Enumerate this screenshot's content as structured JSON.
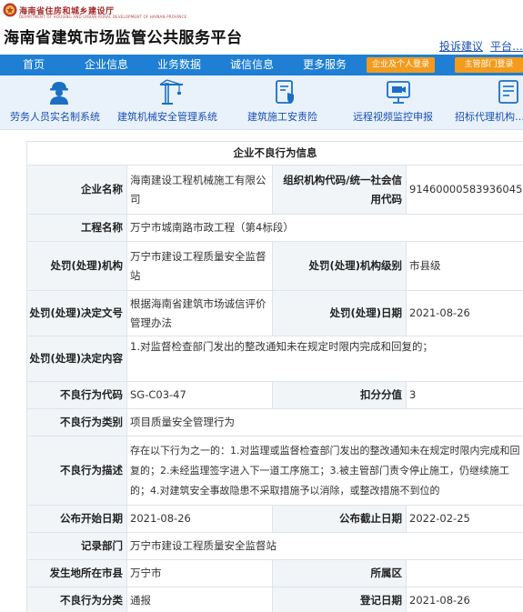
{
  "header": {
    "gov_name": "海南省住房和城乡建设厅",
    "gov_subtitle": "DEPARTMENT OF HOUSING AND URBAN-RURAL DEVELOPMENT OF HAINAN PROVINCE",
    "site_title": "海南省建筑市场监管公共服务平台",
    "links": [
      "投诉建议",
      "平台…"
    ]
  },
  "nav": {
    "items": [
      "首页",
      "企业信息",
      "业务数据",
      "诚信信息",
      "更多服务"
    ],
    "buttons": [
      "企业及个人登录",
      "主管部门登录"
    ]
  },
  "systems": [
    {
      "label": "劳务人员实名制系统",
      "icon": "worker-icon"
    },
    {
      "label": "建筑机械安全管理系统",
      "icon": "tower-crane-icon"
    },
    {
      "label": "建筑施工安责险",
      "icon": "insurance-document-icon"
    },
    {
      "label": "远程视频监控申报",
      "icon": "video-monitor-icon"
    },
    {
      "label": "招标代理机构…",
      "icon": "bidding-document-icon"
    }
  ],
  "record": {
    "title": "企业不良行为信息",
    "labels": {
      "company_name": "企业名称",
      "org_code": "组织机构代码/统一社会信用代码",
      "project_name": "工程名称",
      "penalty_agency": "处罚(处理)机构",
      "agency_level": "处罚(处理)机构级别",
      "decision_doc": "处罚(处理)决定文号",
      "decision_date": "处罚(处理)日期",
      "decision_content": "处罚(处理)决定内容",
      "behavior_code": "不良行为代码",
      "deduction": "扣分分值",
      "behavior_category": "不良行为类别",
      "behavior_desc": "不良行为描述",
      "publish_start": "公布开始日期",
      "publish_end": "公布截止日期",
      "record_dept": "记录部门",
      "city": "发生地所在市县",
      "district": "所属区",
      "behavior_class": "不良行为分类",
      "register_date": "登记日期"
    },
    "values": {
      "company_name": "海南建设工程机械施工有限公司",
      "org_code": "91460000583936045G",
      "project_name": "万宁市城南路市政工程（第4标段）",
      "penalty_agency": "万宁市建设工程质量安全监督站",
      "agency_level": "市县级",
      "decision_doc": "根据海南省建筑市场诚信评价管理办法",
      "decision_date": "2021-08-26",
      "decision_content": "1.对监督检查部门发出的整改通知未在规定时限内完成和回复的；",
      "behavior_code": "SG-C03-47",
      "deduction": "3",
      "behavior_category": "项目质量安全管理行为",
      "behavior_desc": "存在以下行为之一的：1.对监理或监督检查部门发出的整改通知未在规定时限内完成和回复的；2.未经监理签字进入下一道工序施工；3.被主管部门责令停止施工，仍继续施工的；4.对建筑安全事故隐患不采取措施予以消除，或整改措施不到位的",
      "publish_start": "2021-08-26",
      "publish_end": "2022-02-25",
      "record_dept": "万宁市建设工程质量安全监督站",
      "city": "万宁市",
      "district": "",
      "behavior_class": "通报",
      "register_date": "2021-08-26"
    }
  },
  "colors": {
    "nav_bg": "#1e7fd4",
    "login_btn": "#f39b1d",
    "link": "#1a4fb5",
    "label_bg": "#f2f5f8"
  }
}
